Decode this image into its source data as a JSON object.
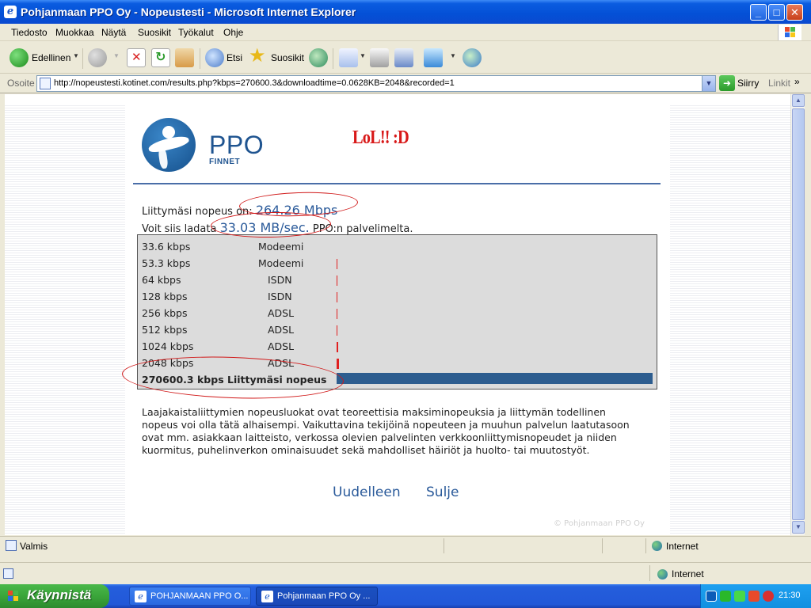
{
  "window": {
    "title": "Pohjanmaan PPO Oy - Nopeustesti - Microsoft Internet Explorer",
    "minimize": "_",
    "maximize": "□",
    "close": "✕"
  },
  "menu": [
    "Tiedosto",
    "Muokkaa",
    "Näytä",
    "Suosikit",
    "Työkalut",
    "Ohje"
  ],
  "toolbar": {
    "back_label": "Edellinen",
    "search_label": "Etsi",
    "favorites_label": "Suosikit"
  },
  "address": {
    "label": "Osoite",
    "url": "http://nopeustesti.kotinet.com/results.php?kbps=270600.3&downloadtime=0.0628KB=2048&recorded=1",
    "go_label": "Siirry",
    "links_label": "Linkit"
  },
  "page": {
    "logo_text": "PPO",
    "logo_subtext": "FINNET",
    "annotation": "LoL!! :D",
    "speed_prefix": "Liittymäsi nopeus on:",
    "speed_value": "264.26 Mbps",
    "download_prefix": "Voit siis ladata",
    "download_value": "33.03 MB/sec.",
    "download_suffix": "PPO:n palvelimelta.",
    "rows": [
      {
        "speed": "33.6 kbps",
        "type": "Modeemi"
      },
      {
        "speed": "53.3 kbps",
        "type": "Modeemi"
      },
      {
        "speed": "64 kbps",
        "type": "ISDN"
      },
      {
        "speed": "128 kbps",
        "type": "ISDN"
      },
      {
        "speed": "256 kbps",
        "type": "ADSL"
      },
      {
        "speed": "512 kbps",
        "type": "ADSL"
      },
      {
        "speed": "1024 kbps",
        "type": "ADSL"
      },
      {
        "speed": "2048 kbps",
        "type": "ADSL"
      }
    ],
    "result_row": "270600.3 kbps Liittymäsi nopeus",
    "description": "Laajakaistaliittymien nopeusluokat ovat teoreettisia maksiminopeuksia ja liittymän todellinen nopeus voi olla tätä alhaisempi. Vaikuttavina tekijöinä nopeuteen ja muuhun palvelun laatutasoon ovat mm. asiakkaan laitteisto, verkossa olevien palvelinten verkkoonliittymisnopeudet ja niiden kuormitus, puhelinverkon ominaisuudet sekä mahdolliset häiriöt ja huolto- tai muutostyöt.",
    "retry_label": "Uudelleen",
    "close_label": "Sulje",
    "copyright": "© Pohjanmaan PPO Oy"
  },
  "status": {
    "text": "Valmis",
    "zone": "Internet",
    "zone2": "Internet"
  },
  "taskbar": {
    "start_label": "Käynnistä",
    "tasks": [
      "POHJANMAAN PPO O...",
      "Pohjanmaan PPO Oy ..."
    ],
    "clock": "21:30"
  }
}
